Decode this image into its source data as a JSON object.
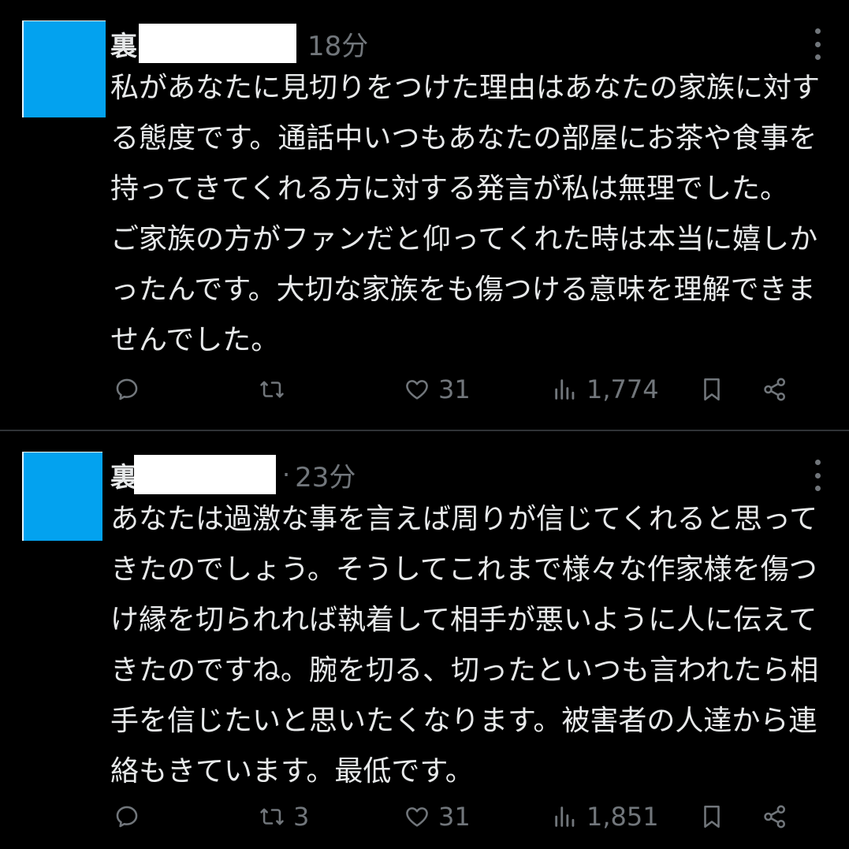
{
  "posts": [
    {
      "display_name": "裏",
      "separator": "",
      "timestamp": "18分",
      "body": "私があなたに見切りをつけた理由はあなたの家族に対する態度です。通話中いつもあなたの部屋にお茶や食事を持ってきてくれる方に対する発言が私は無理でした。 ご家族の方がファンだと仰ってくれた時は本当に嬉しかったんです。大切な家族をも傷つける意味を理解できませんでした。",
      "actions": {
        "reply_count": "",
        "retweet_count": "",
        "like_count": "31",
        "view_count": "1,774"
      },
      "icons": [
        "reply-icon",
        "retweet-icon",
        "like-icon",
        "views-icon",
        "bookmark-icon",
        "share-icon",
        "more-icon"
      ]
    },
    {
      "display_name": "裏",
      "separator": "·",
      "timestamp": "23分",
      "body": "あなたは過激な事を言えば周りが信じてくれると思ってきたのでしょう。そうしてこれまで様々な作家様を傷つけ縁を切られれば執着して相手が悪いように人に伝えてきたのですね。腕を切る、切ったといつも言われたら相手を信じたいと思いたくなります。被害者の人達から連絡もきています。最低です。",
      "actions": {
        "reply_count": "",
        "retweet_count": "3",
        "like_count": "31",
        "view_count": "1,851"
      },
      "icons": [
        "reply-icon",
        "retweet-icon",
        "like-icon",
        "views-icon",
        "bookmark-icon",
        "share-icon",
        "more-icon"
      ]
    }
  ],
  "colors": {
    "background": "#000000",
    "text": "#e7e9ea",
    "muted": "#71767b",
    "avatar": "#03a2ef",
    "divider": "#2f3336",
    "redaction": "#ffffff"
  }
}
